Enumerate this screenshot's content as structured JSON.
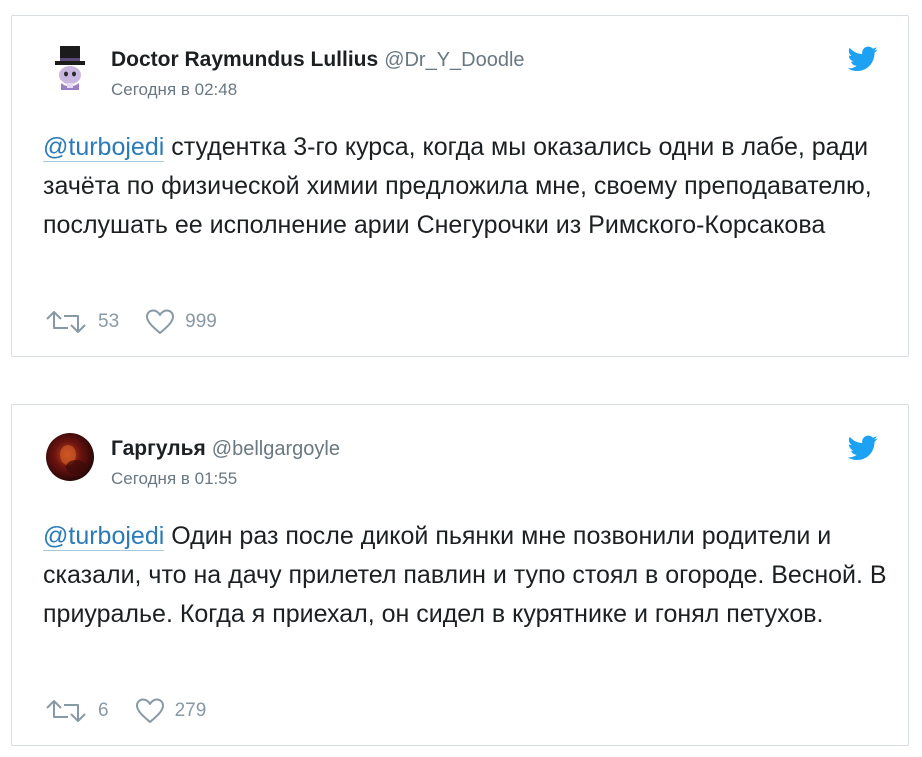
{
  "tweets": [
    {
      "author_name": "Doctor Raymundus Lullius",
      "author_handle": "@Dr_Y_Doodle",
      "timestamp": "Сегодня в 02:48",
      "mention": "@turbojedi",
      "text": " студентка 3-го курса, когда мы оказались одни в лабе, ради зачёта по физической химии предложила мне, своему преподавателю, послушать ее исполнение арии Снегурочки из Римского-Корсакова",
      "retweets": "53",
      "likes": "999",
      "avatar_icon": "top-hat-character-avatar"
    },
    {
      "author_name": "Гаргулья",
      "author_handle": "@bellgargoyle",
      "timestamp": "Сегодня в 01:55",
      "mention": "@turbojedi",
      "text": " Один раз после дикой пьянки мне позвонили родители и сказали, что на дачу прилетел павлин и тупо стоял в огороде. Весной. В приуралье. Когда я приехал, он сидел в курятнике и гонял петухов.",
      "retweets": "6",
      "likes": "279",
      "avatar_icon": "dark-red-photo-avatar"
    }
  ],
  "colors": {
    "twitter_blue": "#1da1f2",
    "link_blue": "#2b7bb9",
    "muted_gray": "#697882",
    "action_gray": "#8899a6",
    "border": "#d8dde2"
  }
}
